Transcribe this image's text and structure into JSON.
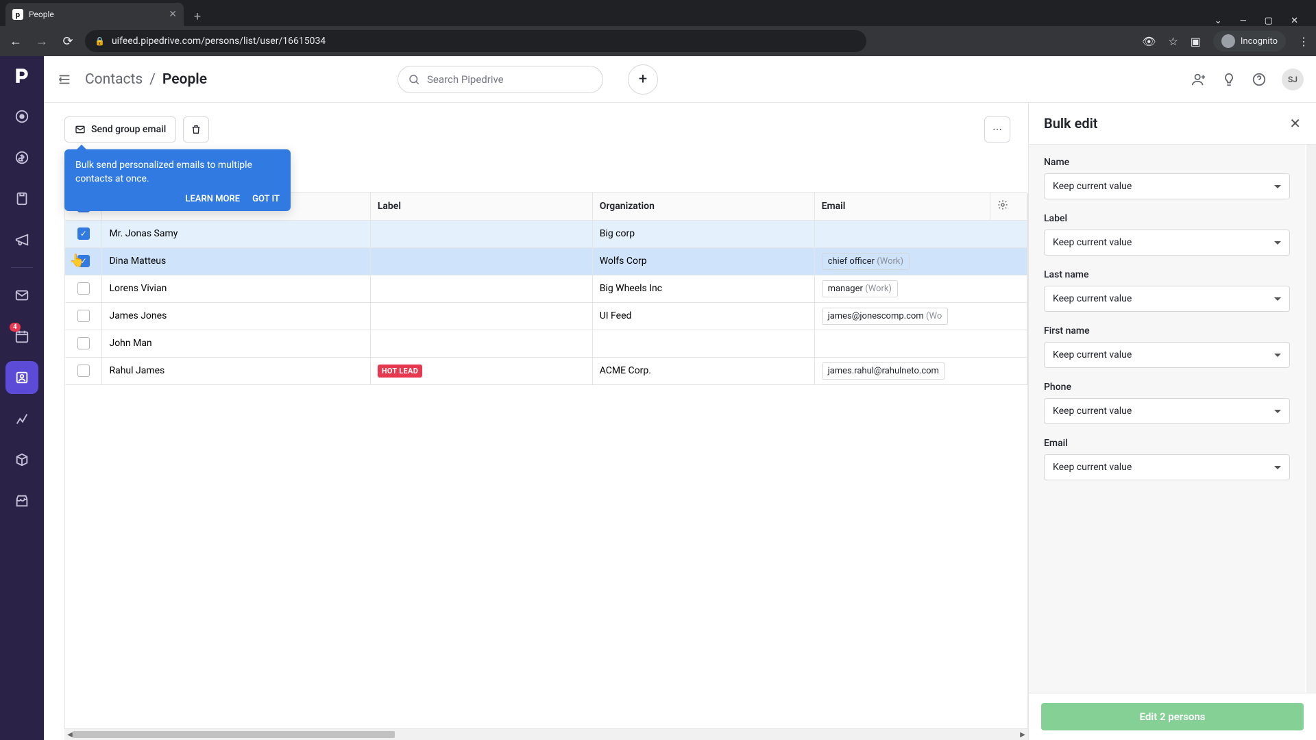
{
  "browser": {
    "tab_title": "People",
    "favicon_letter": "p",
    "url": "uifeed.pipedrive.com/persons/list/user/16615034",
    "incognito_label": "Incognito"
  },
  "sidebar": {
    "badge_count": "4"
  },
  "topbar": {
    "breadcrumb_parent": "Contacts",
    "breadcrumb_separator": "/",
    "breadcrumb_current": "People",
    "search_placeholder": "Search Pipedrive",
    "avatar_initials": "SJ"
  },
  "toolbar": {
    "send_group_email": "Send group email"
  },
  "tooltip": {
    "text": "Bulk send personalized emails to multiple contacts at once.",
    "learn_more": "LEARN MORE",
    "got_it": "GOT IT"
  },
  "table": {
    "headers": {
      "label": "Label",
      "organization": "Organization",
      "email": "Email"
    },
    "rows": [
      {
        "selected": true,
        "name": "Mr. Jonas Samy",
        "label": "",
        "organization": "Big corp",
        "email": "",
        "email_type": ""
      },
      {
        "selected": true,
        "hover": true,
        "name": "Dina Matteus",
        "label": "",
        "organization": "Wolfs Corp",
        "email": "chief officer",
        "email_type": "(Work)"
      },
      {
        "selected": false,
        "name": "Lorens Vivian",
        "label": "",
        "organization": "Big Wheels Inc",
        "email": "manager",
        "email_type": "(Work)"
      },
      {
        "selected": false,
        "name": "James Jones",
        "label": "",
        "organization": "UI Feed",
        "email": "james@jonescomp.com",
        "email_type": "(Wo"
      },
      {
        "selected": false,
        "name": "John Man",
        "label": "",
        "organization": "",
        "email": "",
        "email_type": ""
      },
      {
        "selected": false,
        "name": "Rahul James",
        "label": "HOT LEAD",
        "organization": "ACME Corp.",
        "email": "james.rahul@rahulneto.com",
        "email_type": ""
      }
    ]
  },
  "panel": {
    "title": "Bulk edit",
    "keep_value": "Keep current value",
    "fields": {
      "name": "Name",
      "label": "Label",
      "last_name": "Last name",
      "first_name": "First name",
      "phone": "Phone",
      "email": "Email"
    },
    "save_button": "Edit 2 persons"
  }
}
